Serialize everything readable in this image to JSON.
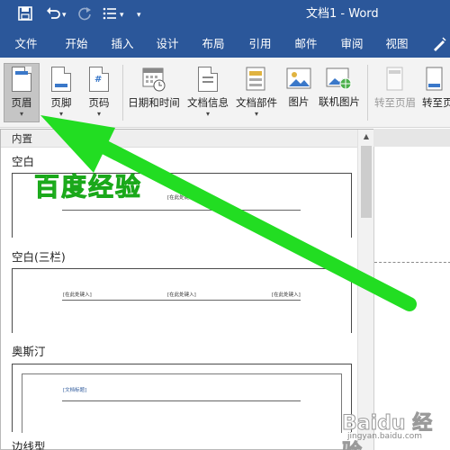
{
  "window": {
    "title": "文档1 - Word"
  },
  "qat": {
    "undo_arrow": "▾",
    "customize": "▾"
  },
  "tabs": [
    {
      "label": "文件"
    },
    {
      "label": "开始"
    },
    {
      "label": "插入"
    },
    {
      "label": "设计"
    },
    {
      "label": "布局"
    },
    {
      "label": "引用"
    },
    {
      "label": "邮件"
    },
    {
      "label": "审阅"
    },
    {
      "label": "视图"
    }
  ],
  "ribbon": {
    "header": {
      "label": "页眉",
      "dd": "▾"
    },
    "footer": {
      "label": "页脚",
      "dd": "▾"
    },
    "page_number": {
      "label": "页码",
      "dd": "▾"
    },
    "date_time": {
      "label": "日期和时间"
    },
    "doc_info": {
      "label": "文档信息",
      "dd": "▾"
    },
    "doc_parts": {
      "label": "文档部件",
      "dd": "▾"
    },
    "picture": {
      "label": "图片"
    },
    "online_picture": {
      "label": "联机图片"
    },
    "go_to_header": {
      "label": "转至页眉"
    },
    "go_to_footer": {
      "label": "转至页"
    }
  },
  "gallery": {
    "header": "内置",
    "sections": [
      {
        "label": "空白",
        "placeholder": "[在此处键入]"
      },
      {
        "label": "空白(三栏)",
        "placeholder": "[在此处键入]"
      },
      {
        "label": "奥斯汀",
        "placeholder": "[文档标题]"
      },
      {
        "label": "边线型"
      }
    ]
  },
  "watermark": {
    "text": "百度经验",
    "baidu": "Baidu 经验",
    "baidu_url": "jingyan.baidu.com"
  },
  "colors": {
    "accent": "#2b579a",
    "arrow": "#22dd22"
  }
}
